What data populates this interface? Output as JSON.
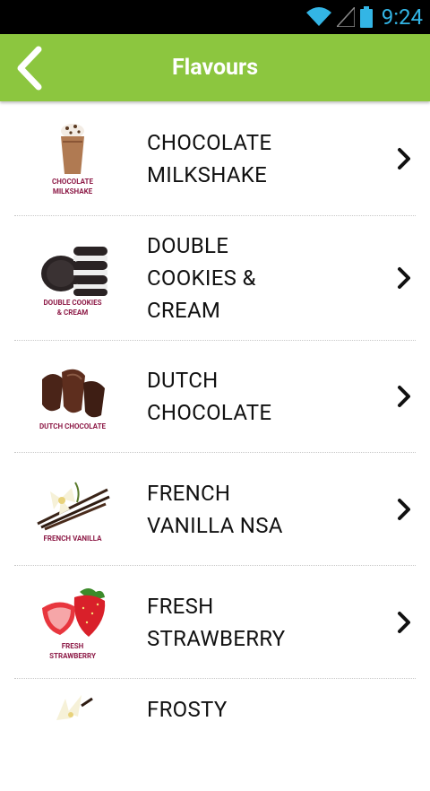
{
  "status_bar": {
    "time": "9:24",
    "icons": [
      "wifi-icon",
      "signal-icon",
      "battery-icon"
    ]
  },
  "app_bar": {
    "title": "Flavours",
    "back_icon": "back-chevron-icon"
  },
  "colors": {
    "app_bar": "#8cc63f",
    "status_accent": "#33b5e5",
    "caption": "#8e1c48"
  },
  "items": [
    {
      "line1": "CHOCOLATE",
      "line2": "MILKSHAKE",
      "line3": "",
      "caption1": "CHOCOLATE",
      "caption2": "MILKSHAKE"
    },
    {
      "line1": "DOUBLE",
      "line2": "COOKIES &",
      "line3": "CREAM",
      "caption1": "DOUBLE COOKIES",
      "caption2": "& CREAM"
    },
    {
      "line1": "DUTCH",
      "line2": "CHOCOLATE",
      "line3": "",
      "caption1": "DUTCH CHOCOLATE",
      "caption2": ""
    },
    {
      "line1": "FRENCH",
      "line2": "VANILLA NSA",
      "line3": "",
      "caption1": "FRENCH VANILLA",
      "caption2": ""
    },
    {
      "line1": "FRESH",
      "line2": "STRAWBERRY",
      "line3": "",
      "caption1": "FRESH",
      "caption2": "STRAWBERRY"
    },
    {
      "line1": "FROSTY",
      "line2": "",
      "line3": "",
      "caption1": "",
      "caption2": ""
    }
  ]
}
